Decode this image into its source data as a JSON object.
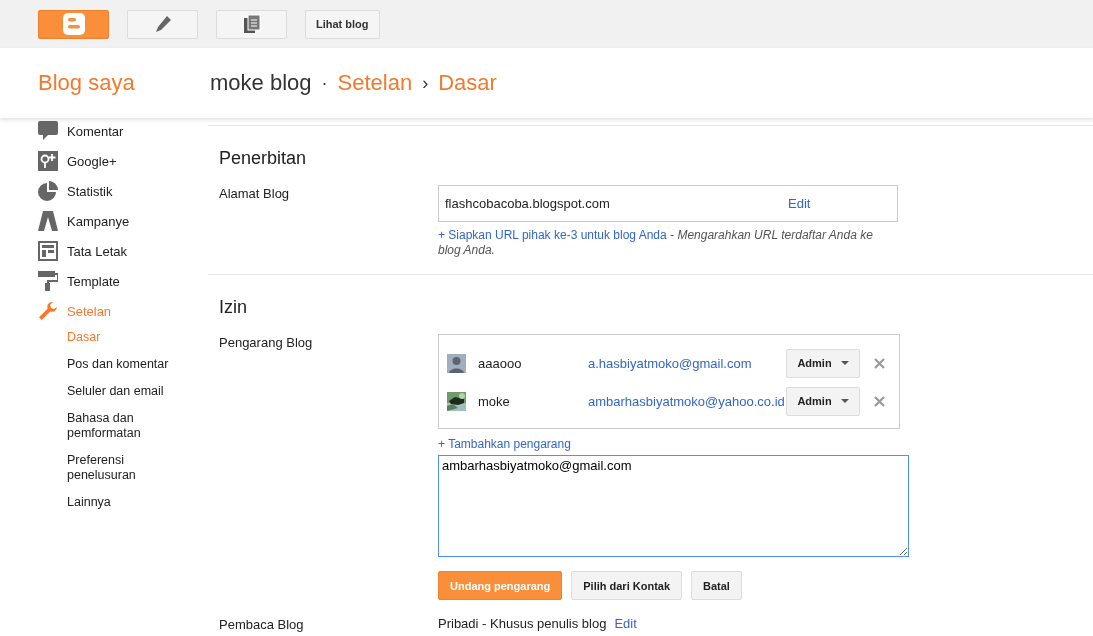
{
  "topbar": {
    "buttons": [
      {
        "kind": "logo"
      },
      {
        "kind": "pencil"
      },
      {
        "kind": "pages"
      },
      {
        "kind": "text",
        "label": "Lihat blog"
      }
    ]
  },
  "header": {
    "title": "Blog saya",
    "breadcrumb": [
      {
        "label": "moke blog",
        "kind": "blog"
      },
      {
        "label": "·",
        "kind": "separator"
      },
      {
        "label": "Setelan",
        "kind": "link"
      },
      {
        "label": "›",
        "kind": "separator"
      },
      {
        "label": "Dasar",
        "kind": "link"
      }
    ]
  },
  "sidebar": {
    "items": [
      {
        "label": "Komentar",
        "selected": false
      },
      {
        "label": "Google+",
        "selected": false
      },
      {
        "label": "Statistik",
        "selected": false
      },
      {
        "label": "Kampanye",
        "selected": false
      },
      {
        "label": "Tata Letak",
        "selected": false
      },
      {
        "label": "Template",
        "selected": false
      },
      {
        "label": "Setelan",
        "selected": true,
        "children": [
          {
            "label": "Dasar",
            "selected": true
          },
          {
            "label": "Pos dan komentar",
            "selected": false
          },
          {
            "label": "Seluler dan email",
            "selected": false
          },
          {
            "label": "Bahasa dan pemformatan",
            "selected": false
          },
          {
            "label": "Preferensi penelusuran",
            "selected": false
          },
          {
            "label": "Lainnya",
            "selected": false
          }
        ]
      }
    ]
  },
  "sections": [
    {
      "title": "Penerbitan",
      "rows": [
        {
          "kind": "address",
          "label": "Alamat Blog",
          "value": "flashcobacoba.blogspot.com",
          "action": "Edit",
          "hint_link": "+ Siapkan URL pihak ke-3 untuk blog Anda",
          "hint_note": " - Mengarahkan URL terdaftar Anda ke blog Anda."
        }
      ]
    },
    {
      "title": "Izin",
      "rows": [
        {
          "kind": "authors",
          "label": "Pengarang Blog",
          "authors": [
            {
              "name": "aaaooo",
              "email": "a.hasbiyatmoko@gmail.com",
              "role": "Admin"
            },
            {
              "name": "moke",
              "email": "ambarhasbiyatmoko@yahoo.co.id",
              "role": "Admin"
            }
          ],
          "add_link": "+ Tambahkan pengarang",
          "invite_value": "ambarhasbiyatmoko@gmail.com",
          "buttons": [
            {
              "label": "Undang pengarang",
              "kind": "primary"
            },
            {
              "label": "Pilih dari Kontak",
              "kind": "secondary"
            },
            {
              "label": "Batal",
              "kind": "secondary"
            }
          ]
        },
        {
          "kind": "readers",
          "label": "Pembaca Blog",
          "value": "Pribadi - Khusus penulis blog",
          "action": "Edit"
        }
      ]
    }
  ]
}
